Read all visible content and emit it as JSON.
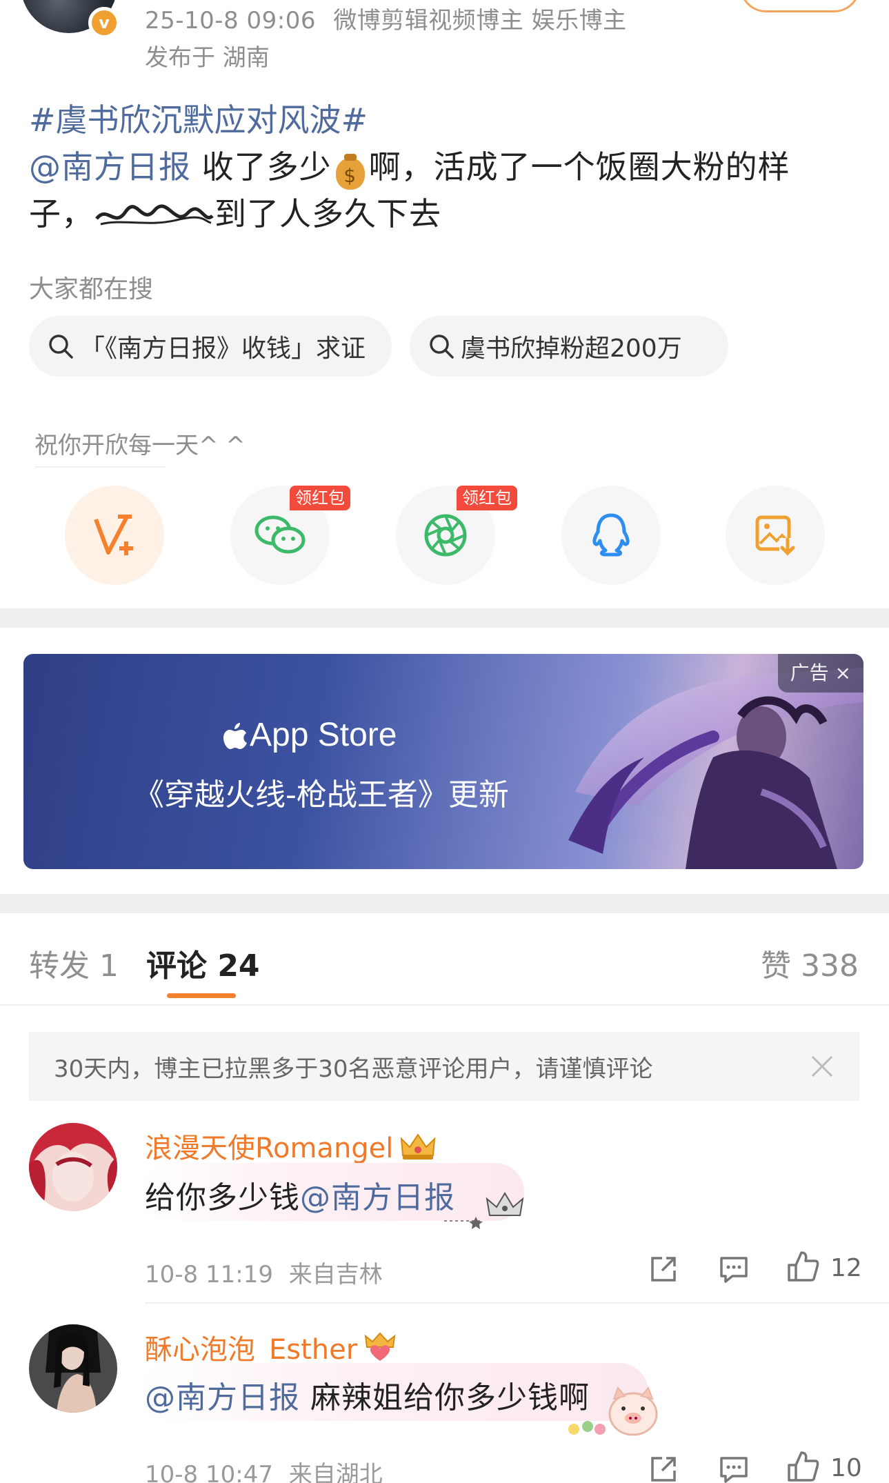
{
  "header": {
    "date_time": "25-10-8 09:06",
    "tags": "微博剪辑视频博主 娱乐博主",
    "location": "发布于 湖南",
    "verified_mark": "v"
  },
  "post": {
    "hashtag": "#虞书欣沉默应对风波#",
    "mention": "@南方日报",
    "line1_text": " 收了多少",
    "line1_rest": "啊，活成了一个饭圈大粉的样",
    "line2_start": "子，",
    "line2_end": "到了人多久下去",
    "money_symbol": "$"
  },
  "trending": {
    "title": "大家都在搜",
    "chips": [
      "「《南方日报》收钱」求证",
      "虞书欣掉粉超200万"
    ]
  },
  "share": {
    "greeting": "祝你开欣每一天^ ^",
    "items": [
      {
        "name": "weibo-share",
        "tag": ""
      },
      {
        "name": "wechat-share",
        "tag": "领红包"
      },
      {
        "name": "moments-share",
        "tag": "领红包"
      },
      {
        "name": "qq-share",
        "tag": ""
      },
      {
        "name": "save-image",
        "tag": ""
      }
    ]
  },
  "ad": {
    "brand": "App Store",
    "subtitle": "《穿越火线-枪战王者》更新",
    "tag": "广告 ×"
  },
  "tabs": {
    "repost": "转发 1",
    "comment": "评论 24",
    "like": "赞 338"
  },
  "notice": {
    "text": "30天内，博主已拉黑多于30名恶意评论用户，请谨慎评论"
  },
  "comments": [
    {
      "username": "浪漫天使Romangel",
      "text_prefix": "给你多少钱",
      "mention": "@南方日报",
      "text_suffix": "",
      "time": "10-8 11:19",
      "location": "来自吉林",
      "likes": "12"
    },
    {
      "username": "酥心泡泡_Esther",
      "text_prefix": "",
      "mention": "@南方日报",
      "text_suffix": " 麻辣姐给你多少钱啊",
      "time": "10-8 10:47",
      "location": "来自湖北",
      "likes": "10"
    }
  ],
  "colors": {
    "accent_orange": "#f5802d",
    "link_blue": "#4f6a9c",
    "username_orange": "#f07a2a",
    "red_tag": "#f34b3b"
  }
}
